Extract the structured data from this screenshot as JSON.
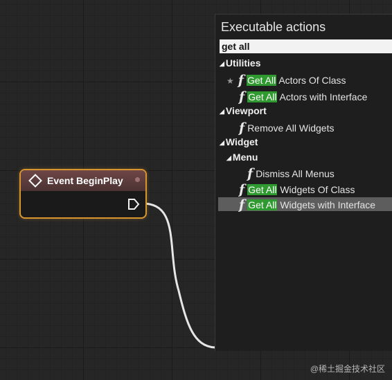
{
  "event_node": {
    "title": "Event BeginPlay"
  },
  "actions_panel": {
    "title": "Executable actions",
    "search_value": "get all",
    "categories": {
      "utilities": "Utilities",
      "viewport": "Viewport",
      "widget": "Widget",
      "menu": "Menu"
    },
    "items": [
      {
        "highlight": "Get All",
        "rest": " Actors Of Class"
      },
      {
        "highlight": "Get All",
        "rest": " Actors with Interface"
      },
      {
        "highlight": "",
        "rest": "Remove All Widgets"
      },
      {
        "highlight": "",
        "rest": "Dismiss All Menus"
      },
      {
        "highlight": "Get All",
        "rest": " Widgets Of Class"
      },
      {
        "highlight": "Get All",
        "rest": " Widgets with Interface"
      }
    ]
  },
  "watermark": "@稀土掘金技术社区",
  "colors": {
    "node_border": "#d9962e",
    "highlight": "#2f9a2f",
    "selected_row": "#5d5d5d"
  }
}
